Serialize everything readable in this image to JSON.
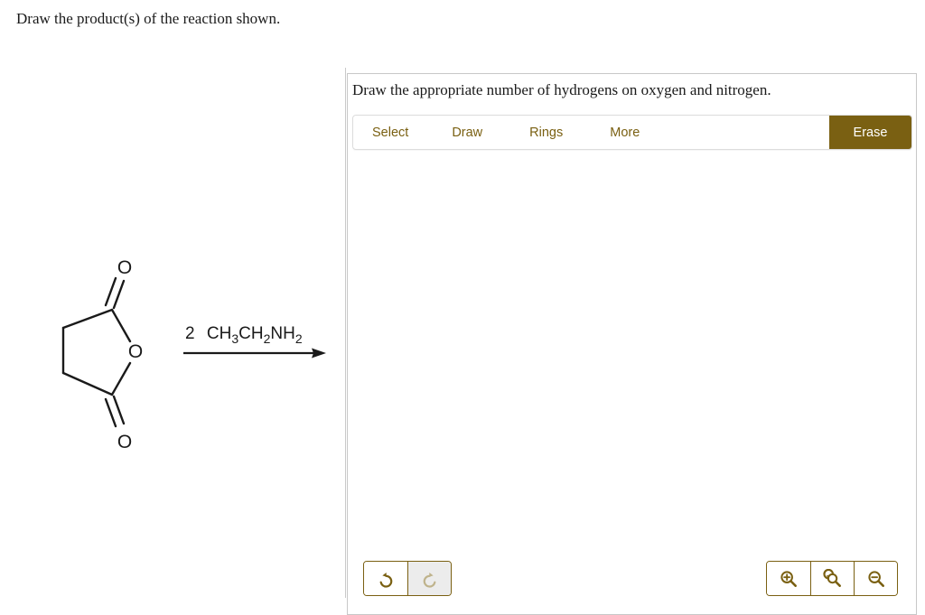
{
  "question": {
    "prompt": "Draw the product(s) of the reaction shown."
  },
  "reaction": {
    "reactant_name": "succinic anhydride",
    "reagent_text": "2  CH3CH2NH2",
    "reagent_parts": [
      {
        "text": "2",
        "sub": false
      },
      {
        "text": "CH",
        "sub": false
      },
      {
        "text": "3",
        "sub": true
      },
      {
        "text": "CH",
        "sub": false
      },
      {
        "text": "2",
        "sub": true
      },
      {
        "text": "NH",
        "sub": false
      },
      {
        "text": "2",
        "sub": true
      }
    ],
    "atom_labels": {
      "carbonyl_top": "O",
      "ring_oxygen": "O",
      "carbonyl_bottom": "O"
    },
    "arrow_direction": "right"
  },
  "panel": {
    "instruction": "Draw the appropriate number of hydrogens on oxygen and nitrogen.",
    "toolbar": {
      "tabs": [
        {
          "label": "Select",
          "name": "select"
        },
        {
          "label": "Draw",
          "name": "draw"
        },
        {
          "label": "Rings",
          "name": "rings"
        },
        {
          "label": "More",
          "name": "more"
        }
      ],
      "erase_label": "Erase"
    },
    "history_controls": [
      {
        "name": "undo",
        "icon": "undo-icon",
        "enabled": true
      },
      {
        "name": "redo",
        "icon": "redo-icon",
        "enabled": false
      }
    ],
    "zoom_controls": [
      {
        "name": "zoom-in",
        "icon": "zoom-in-icon"
      },
      {
        "name": "zoom-reset",
        "icon": "zoom-reset-icon"
      },
      {
        "name": "zoom-out",
        "icon": "zoom-out-icon"
      }
    ],
    "canvas_content": ""
  },
  "colors": {
    "accent": "#7a6012",
    "erase_bg": "#7a6012",
    "erase_text": "#ffffff",
    "panel_border": "#c8c8c8",
    "toolbar_border": "#dcdcdc",
    "disabled_bg": "#ececec",
    "disabled_icon": "#bfb38c",
    "text": "#1a1a1a",
    "divider": "#c9c9c9",
    "structure_line": "#1a1a1a"
  }
}
